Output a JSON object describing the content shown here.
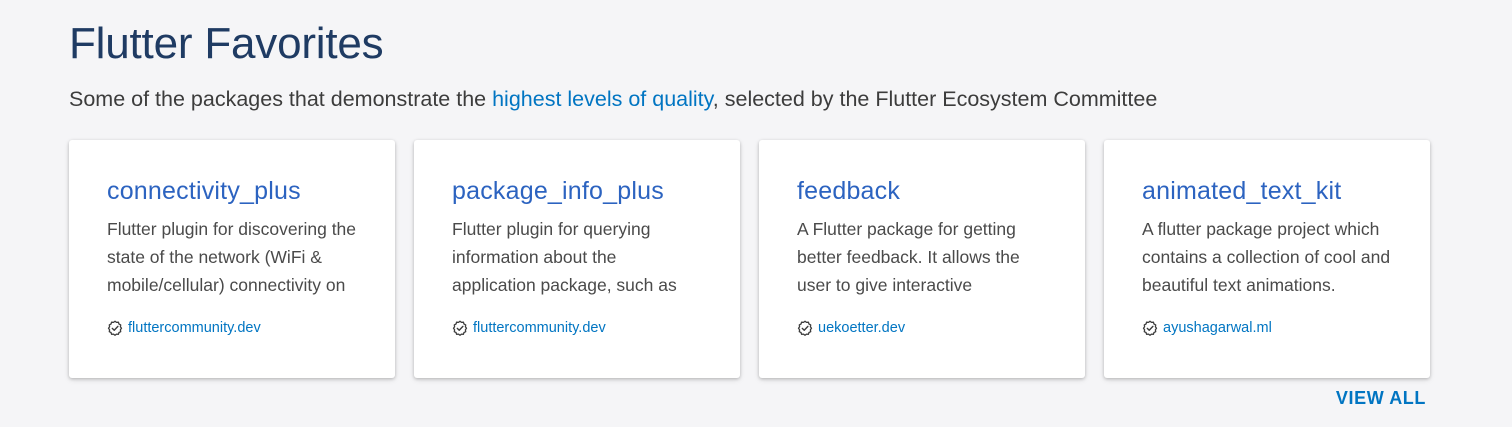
{
  "section": {
    "title": "Flutter Favorites",
    "subtitle_prefix": "Some of the packages that demonstrate the ",
    "subtitle_link": "highest levels of quality",
    "subtitle_suffix": ", selected by the Flutter Ecosystem Committee"
  },
  "cards": [
    {
      "name": "connectivity_plus",
      "description": "Flutter plugin for discovering the state of the network (WiFi & mobile/cellular) connectivity on",
      "publisher": "fluttercommunity.dev",
      "publisher_icon": "verified-publisher-icon"
    },
    {
      "name": "package_info_plus",
      "description": "Flutter plugin for querying information about the application package, such as",
      "publisher": "fluttercommunity.dev",
      "publisher_icon": "verified-publisher-icon"
    },
    {
      "name": "feedback",
      "description": "A Flutter package for getting better feedback. It allows the user to give interactive",
      "publisher": "uekoetter.dev",
      "publisher_icon": "verified-publisher-icon"
    },
    {
      "name": "animated_text_kit",
      "description": "A flutter package project which contains a collection of cool and beautiful text animations.",
      "publisher": "ayushagarwal.ml",
      "publisher_icon": "verified-publisher-icon"
    }
  ],
  "view_all_label": "VIEW ALL",
  "colors": {
    "background": "#f5f5f7",
    "title": "#1f3b63",
    "card_title": "#2c63c0",
    "link": "#0175c2",
    "text": "#4a4a4a"
  }
}
